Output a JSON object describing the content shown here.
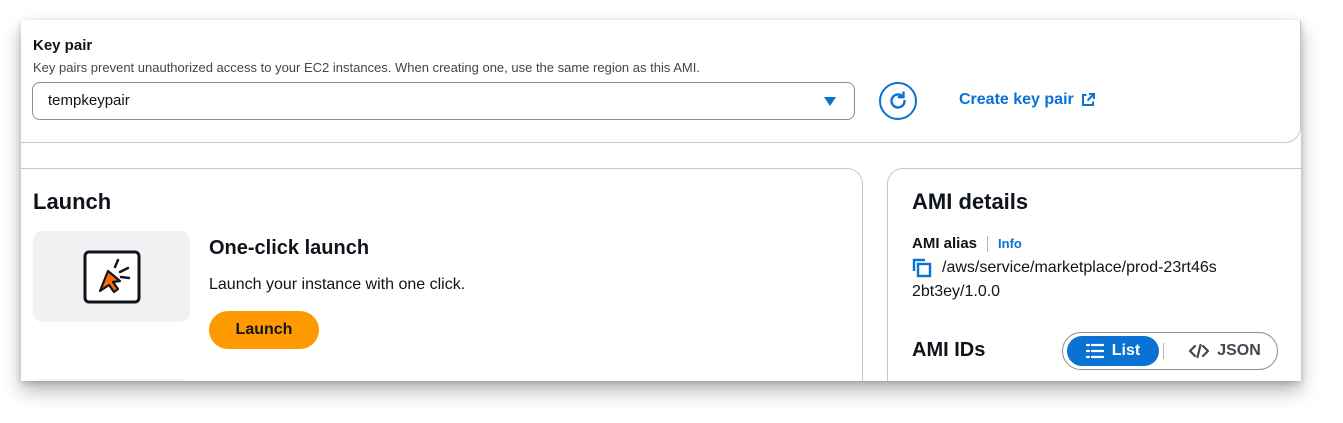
{
  "key_pair": {
    "title": "Key pair",
    "description": "Key pairs prevent unauthorized access to your EC2 instances. When creating one, use the same region as this AMI.",
    "selected_value": "tempkeypair",
    "create_link_label": "Create key pair",
    "refresh_icon": "refresh-icon",
    "external_icon": "external-link-icon"
  },
  "launch": {
    "title": "Launch",
    "option_title": "One-click launch",
    "option_description": "Launch your instance with one click.",
    "button_label": "Launch",
    "icon": "cursor-click-icon"
  },
  "ami_details": {
    "title": "AMI details",
    "alias_label": "AMI alias",
    "info_label": "Info",
    "alias_value_line1": "/aws/service/marketplace/prod-23rt46s",
    "alias_value_line2": "2bt3ey/1.0.0",
    "ids_title": "AMI IDs",
    "toggle": {
      "list_label": "List",
      "json_label": "JSON",
      "selected": "List"
    }
  },
  "colors": {
    "accent": "#0972d3",
    "launch_button": "#ff9900",
    "border": "#c6c6cd",
    "text": "#0f141a"
  }
}
